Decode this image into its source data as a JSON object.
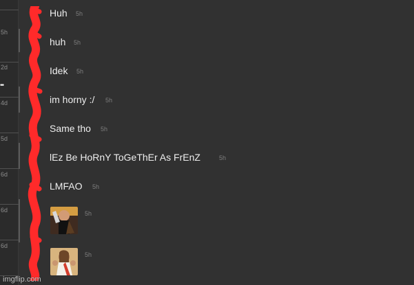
{
  "rail": {
    "times": [
      "5h",
      "5h",
      "2d",
      "4d",
      "5d",
      "6d",
      "6d",
      "6d"
    ],
    "badge": "••"
  },
  "messages": [
    {
      "text": "Huh",
      "time": "5h"
    },
    {
      "text": "huh",
      "time": "5h"
    },
    {
      "text": "Idek",
      "time": "5h"
    },
    {
      "text": "im horny :/",
      "time": "5h"
    },
    {
      "text": "Same tho",
      "time": "5h"
    },
    {
      "text": "lEz Be HoRnY ToGeThEr As FrEnZ",
      "time": "5h"
    },
    {
      "text": "LMFAO",
      "time": "5h"
    }
  ],
  "attachments": [
    {
      "time": "5h",
      "icon": "image-icon"
    },
    {
      "time": "5h",
      "icon": "image-icon"
    }
  ],
  "watermark": "imgflip.com",
  "colors": {
    "background": "#313131",
    "text": "#eeeeee",
    "timestamp": "#7d7d7d",
    "annotation": "#ff2a2a"
  }
}
